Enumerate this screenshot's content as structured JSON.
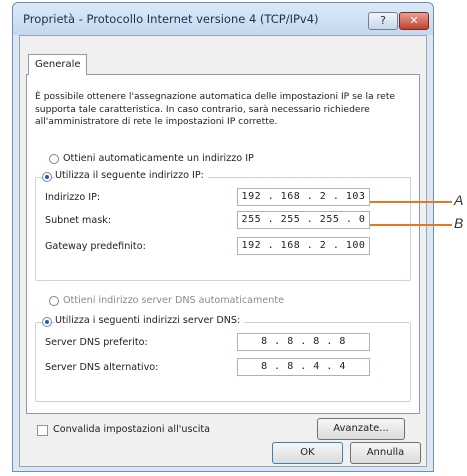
{
  "window": {
    "title": "Proprietà - Protocollo Internet versione 4 (TCP/IPv4)",
    "help_label": "?",
    "close_label": "✕"
  },
  "tab": {
    "label": "Generale"
  },
  "intro": "È possibile ottenere l'assegnazione automatica delle impostazioni IP se la rete supporta tale caratteristica. In caso contrario, sarà necessario richiedere all'amministratore di rete le impostazioni IP corrette.",
  "ip": {
    "auto_label": "Ottieni automaticamente un indirizzo IP",
    "manual_label": "Utilizza il seguente indirizzo IP:",
    "fields": [
      {
        "label": "Indirizzo IP:",
        "value": "192 . 168 .  2  . 103"
      },
      {
        "label": "Subnet mask:",
        "value": "255 . 255 . 255 .  0"
      },
      {
        "label": "Gateway predefinito:",
        "value": "192 . 168 .  2  . 100"
      }
    ]
  },
  "dns": {
    "auto_label": "Ottieni indirizzo server DNS automaticamente",
    "manual_label": "Utilizza i seguenti indirizzi server DNS:",
    "fields": [
      {
        "label": "Server DNS preferito:",
        "value": "8  .  8  .  8  .  8"
      },
      {
        "label": "Server DNS alternativo:",
        "value": "8  .  8  .  4  .  4"
      }
    ]
  },
  "validate_label": "Convalida impostazioni all'uscita",
  "buttons": {
    "advanced": "Avanzate...",
    "ok": "OK",
    "cancel": "Annulla"
  },
  "callouts": {
    "a": "A",
    "b": "B"
  },
  "colors": {
    "callout": "#e87722",
    "selected_radio": "#1b5fb4"
  }
}
